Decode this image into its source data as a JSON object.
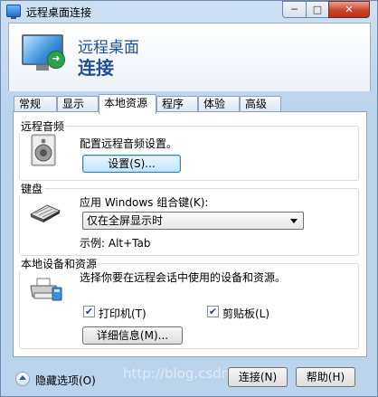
{
  "window": {
    "title": "远程桌面连接",
    "min_symbol": "─",
    "max_symbol": "□",
    "close_symbol": "✕"
  },
  "header": {
    "line1": "远程桌面",
    "line2": "连接"
  },
  "tabs": [
    {
      "label": "常规"
    },
    {
      "label": "显示"
    },
    {
      "label": "本地资源"
    },
    {
      "label": "程序"
    },
    {
      "label": "体验"
    },
    {
      "label": "高级"
    }
  ],
  "audio": {
    "group_label": "远程音频",
    "description": "配置远程音频设置。",
    "button": "设置(S)..."
  },
  "keyboard": {
    "group_label": "键盘",
    "description": "应用 Windows 组合键(K):",
    "selected": "仅在全屏显示时",
    "example": "示例: Alt+Tab"
  },
  "devices": {
    "group_label": "本地设备和资源",
    "description": "选择你要在远程会话中使用的设备和资源。",
    "printer_label": "打印机(T)",
    "printer_checked": true,
    "clipboard_label": "剪贴板(L)",
    "clipboard_checked": true,
    "details_button": "详细信息(M)...",
    "check_mark": "✔"
  },
  "footer": {
    "hide_options": "隐藏选项(O)",
    "connect_button": "连接(N)",
    "help_button": "帮助(H)",
    "watermark": "http://blog.csdn.net/"
  }
}
